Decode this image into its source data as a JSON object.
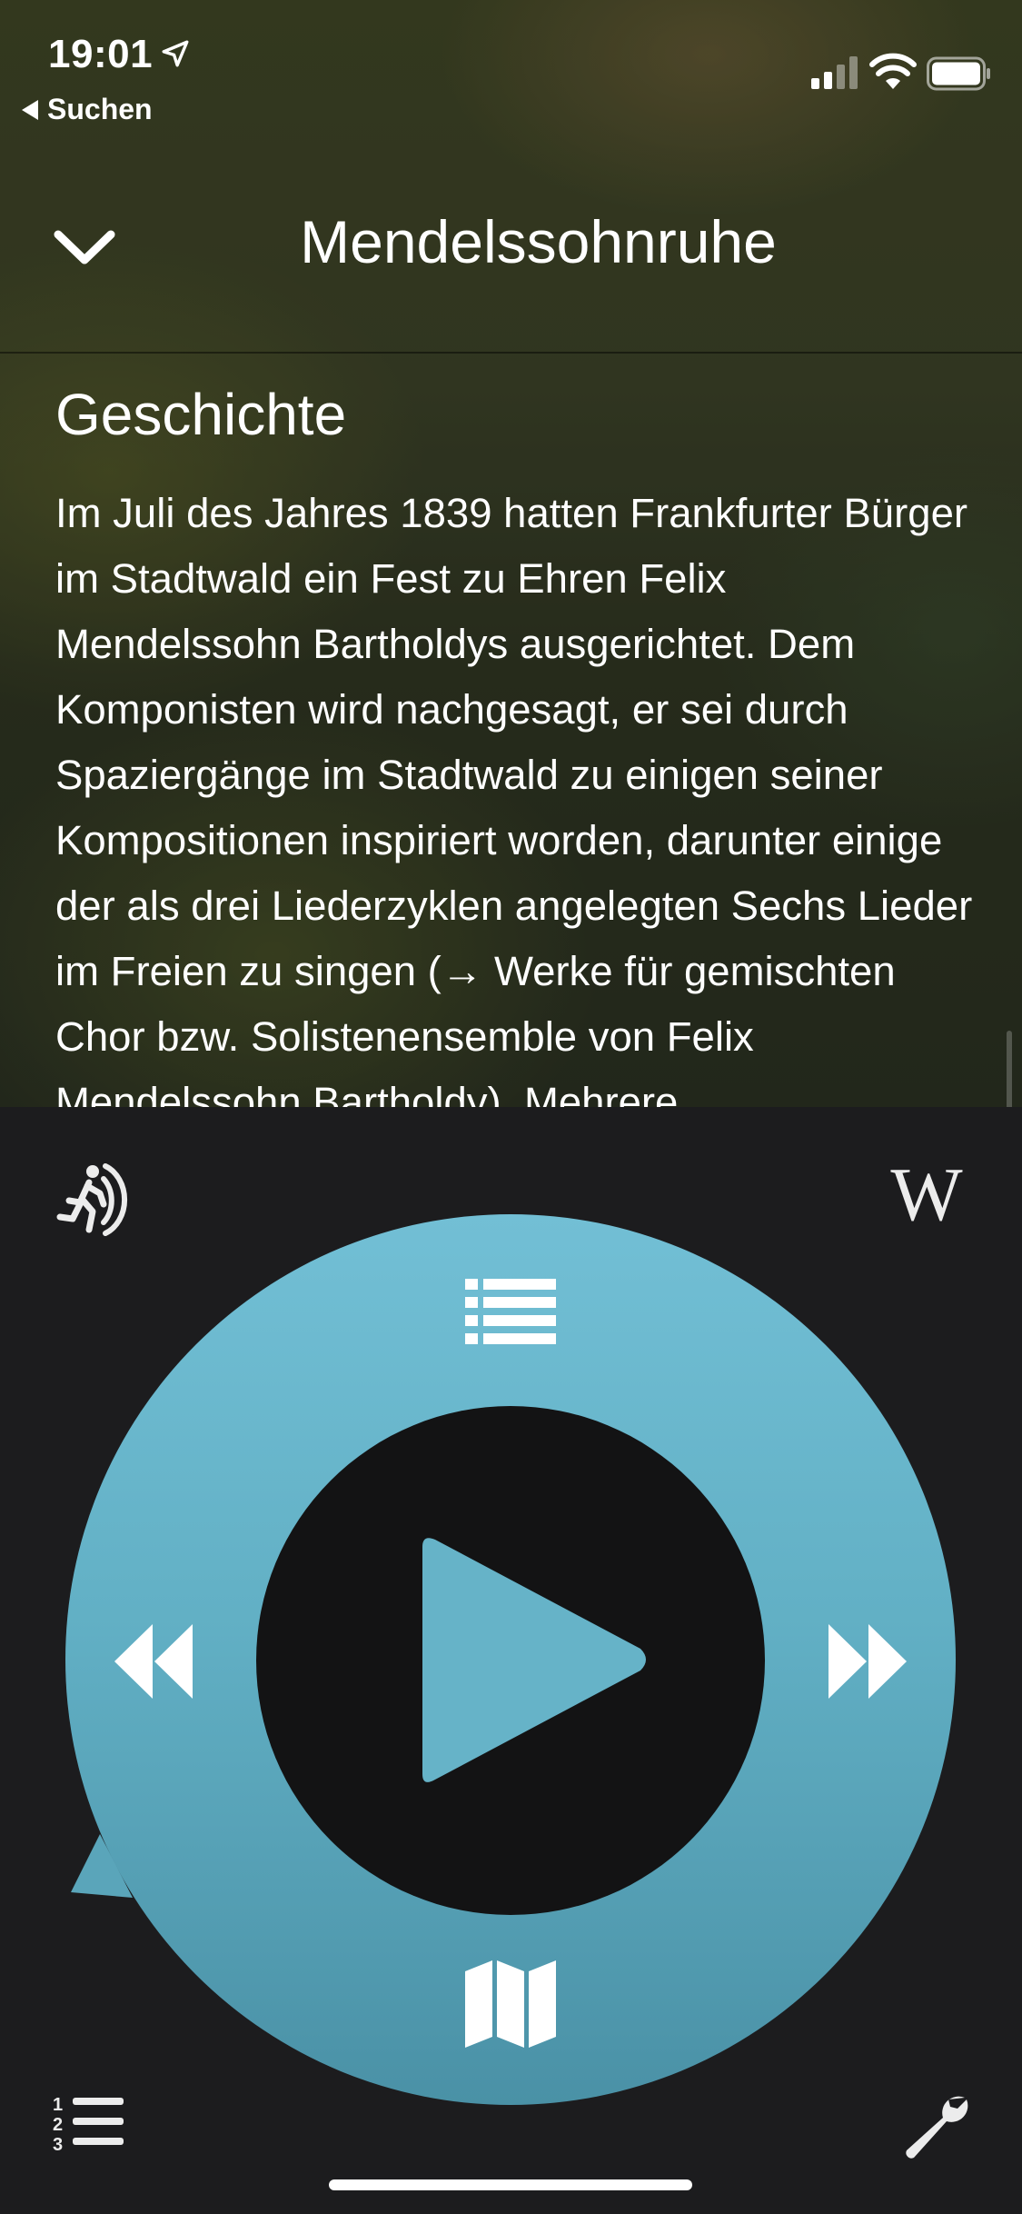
{
  "status_bar": {
    "time": "19:01",
    "back_app": "Suchen"
  },
  "nav": {
    "title": "Mendelssohnruhe"
  },
  "article": {
    "section_title": "Geschichte",
    "body": "Im Juli des Jahres 1839 hatten Frankfurter Bürger im Stadtwald ein Fest zu Ehren Felix Mendelssohn Bartholdys ausgerichtet. Dem Komponisten wird nachgesagt, er sei durch Spaziergänge im Stadtwald zu einigen seiner Kompositionen inspiriert worden, darunter einige der als drei Liederzyklen angelegten Sechs Lieder im Freien zu singen (→ Werke für gemischten Chor bzw. Solistenensemble von Felix Mendelssohn Bartholdy). Mehrere"
  },
  "controls": {
    "wiki_glyph": "W",
    "accent_color": "#68b6cb",
    "icons": [
      "walking-figure-icon",
      "wikipedia-icon",
      "list-icon",
      "rewind-icon",
      "play-icon",
      "fast-forward-icon",
      "map-icon",
      "numbered-list-icon",
      "wrench-icon"
    ]
  }
}
